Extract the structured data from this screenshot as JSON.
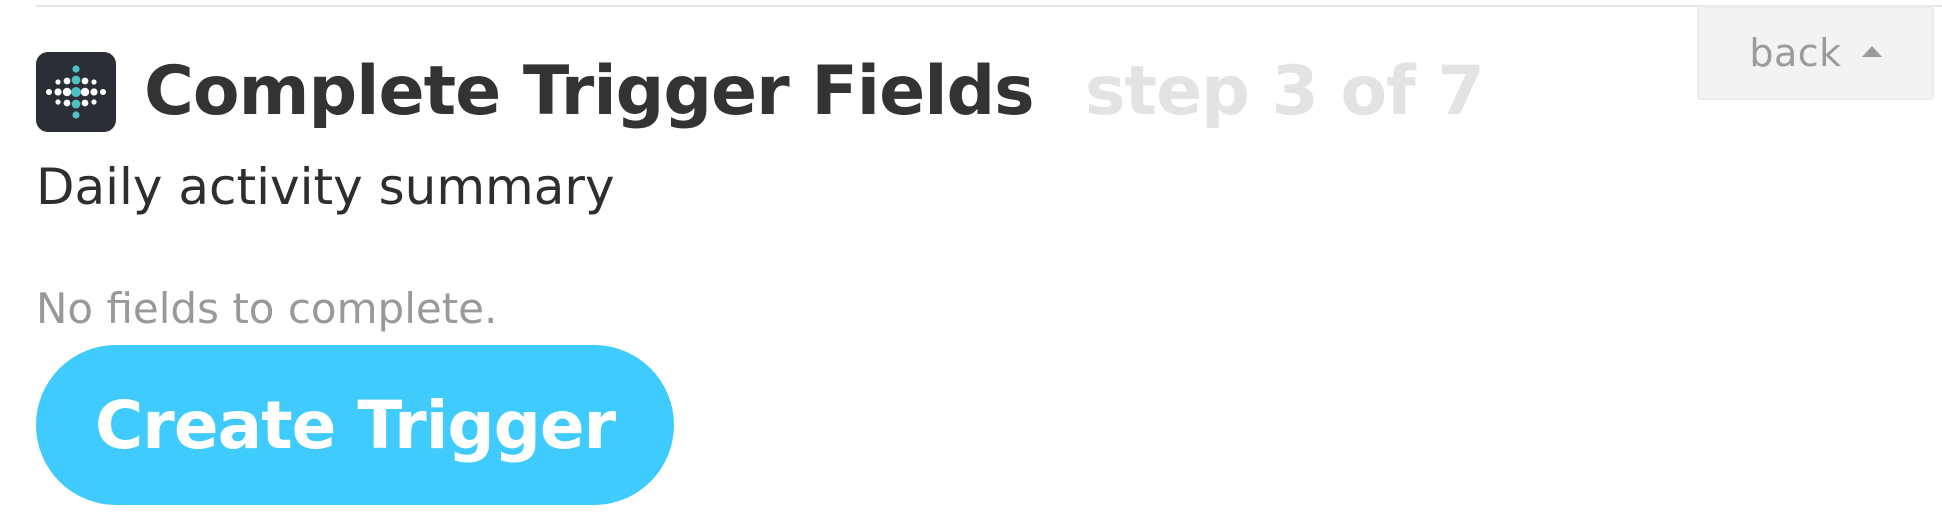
{
  "header": {
    "title": "Complete Trigger Fields",
    "step": "step 3 of 7",
    "back_label": "back",
    "back_icon": "caret-up-icon"
  },
  "service": {
    "icon": "fitbit-logo-icon",
    "icon_bg_color": "#2b2f35",
    "icon_dot_light": "#ffffff",
    "icon_dot_accent": "#4cc2c4"
  },
  "trigger": {
    "name": "Daily activity summary"
  },
  "fields": {
    "message": "No fields to complete."
  },
  "actions": {
    "create_label": "Create Trigger",
    "create_color": "#3fcbfd"
  }
}
